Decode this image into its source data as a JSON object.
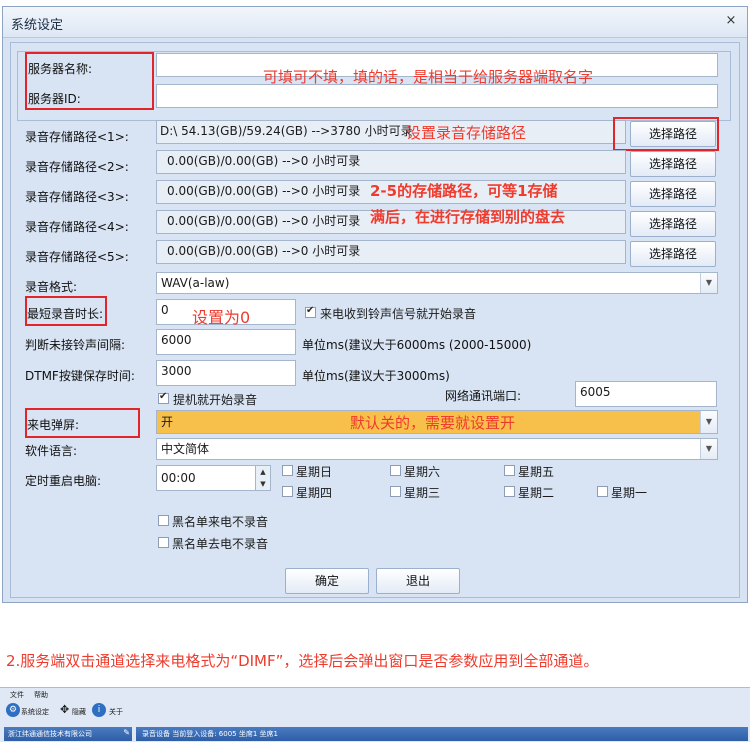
{
  "dialog": {
    "title": "系统设定",
    "close": "×"
  },
  "server": {
    "name_label": "服务器名称:",
    "id_label": "服务器ID:",
    "name_value": "",
    "id_value": ""
  },
  "annotations": {
    "server_hint": "可填可不填，填的话，是相当于给服务器端取名字",
    "path_hint": "设置录音存储路径",
    "multi_path_hint_1": "2-5的存储路径，可等1存储",
    "multi_path_hint_2": "满后，在进行存储到别的盘去",
    "min_length_hint": "设置为0",
    "popup_hint": "默认关的，需要就设置开"
  },
  "storage_paths": [
    {
      "label": "录音存储路径<1>:",
      "value": "D:\\  54.13(GB)/59.24(GB) -->3780 小时可录",
      "button": "选择路径"
    },
    {
      "label": "录音存储路径<2>:",
      "value": "0.00(GB)/0.00(GB) -->0 小时可录",
      "button": "选择路径"
    },
    {
      "label": "录音存储路径<3>:",
      "value": "0.00(GB)/0.00(GB) -->0 小时可录",
      "button": "选择路径"
    },
    {
      "label": "录音存储路径<4>:",
      "value": "0.00(GB)/0.00(GB) -->0 小时可录",
      "button": "选择路径"
    },
    {
      "label": "录音存储路径<5>:",
      "value": "0.00(GB)/0.00(GB) -->0 小时可录",
      "button": "选择路径"
    }
  ],
  "format": {
    "label": "录音格式:",
    "value": "WAV(a-law)"
  },
  "min_length": {
    "label": "最短录音时长:",
    "value": "0",
    "checkbox_label": "来电收到铃声信号就开始录音",
    "checked": true
  },
  "ring_interval": {
    "label": "判断未接铃声间隔:",
    "value": "6000",
    "hint": "单位ms(建议大于6000ms (2000-15000)"
  },
  "dtmf_interval": {
    "label": "DTMF按键保存时间:",
    "value": "3000",
    "hint": "单位ms(建议大于3000ms)"
  },
  "offhook": {
    "label": "提机就开始录音",
    "checked": true
  },
  "network": {
    "label": "网络通讯端口:",
    "value": "6005"
  },
  "popup": {
    "label": "来电弹屏:",
    "value": "开"
  },
  "language": {
    "label": "软件语言:",
    "value": "中文简体"
  },
  "reboot": {
    "label": "定时重启电脑:",
    "value": "00:00"
  },
  "weekdays": [
    "星期日",
    "星期六",
    "星期五",
    "星期四",
    "星期三",
    "星期二",
    "星期一"
  ],
  "blacklist": {
    "incoming": "黑名单来电不录音",
    "outgoing": "黑名单去电不录音"
  },
  "buttons": {
    "ok": "确定",
    "exit": "退出"
  },
  "instruction": "2.服务端双击通道选择来电格式为“DIMF”，选择后会弹出窗口是否参数应用到全部通道。",
  "app": {
    "menu": [
      "文件",
      "帮助"
    ],
    "toolbar": [
      "系统设定",
      "隐藏",
      "关于"
    ],
    "company": "浙江纬通通信技术有限公司",
    "status": "录音设备 当前登入设备: 6005 坐席1 坐席1"
  },
  "colors": {
    "annotation": "#ef3b2d",
    "highlight": "#f7c04a"
  }
}
